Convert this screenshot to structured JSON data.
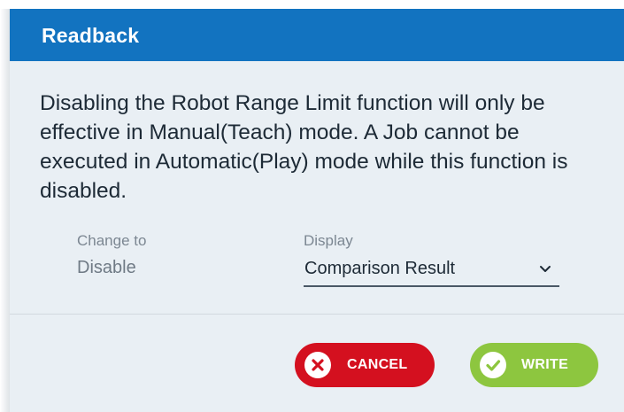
{
  "dialog": {
    "title": "Readback",
    "message": "Disabling the Robot Range Limit function will only be effective in Manual(Teach) mode.  A Job cannot be executed in Automatic(Play) mode while this function is disabled.",
    "change_to": {
      "label": "Change to",
      "value": "Disable"
    },
    "display": {
      "label": "Display",
      "selected": "Comparison Result"
    },
    "buttons": {
      "cancel_label": "CANCEL",
      "write_label": "WRITE"
    }
  },
  "colors": {
    "titlebar": "#1273c0",
    "background": "#e9eff4",
    "cancel": "#d4101f",
    "write": "#8dc63f"
  },
  "icons": {
    "cancel": "close-circle-icon",
    "write": "check-circle-icon",
    "dropdown": "chevron-down-icon"
  }
}
